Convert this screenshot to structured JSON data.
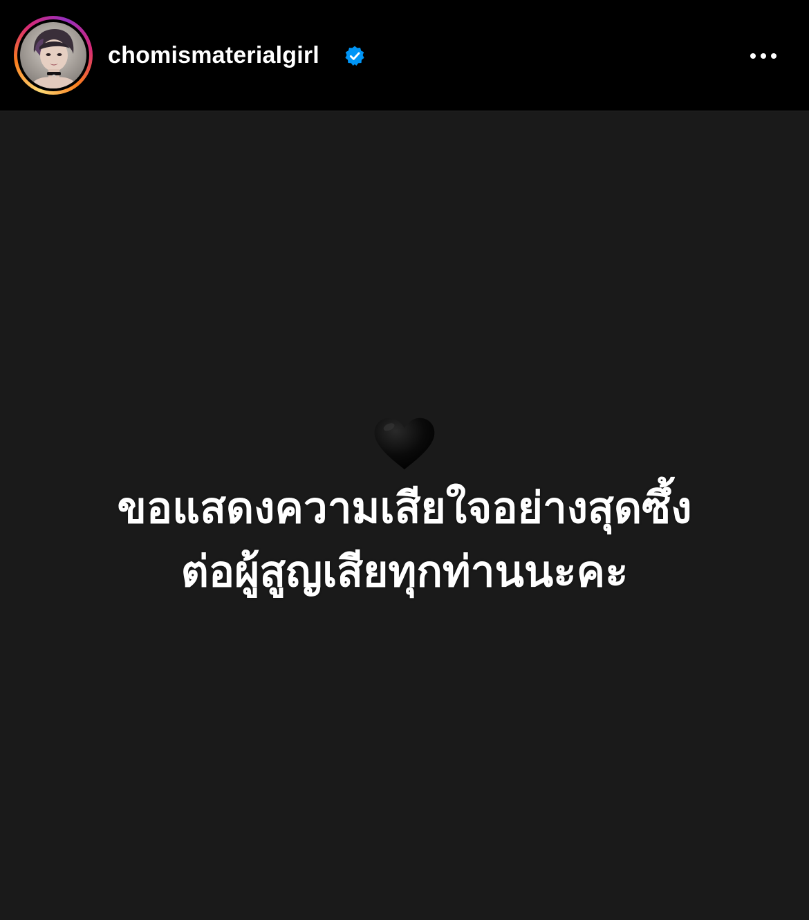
{
  "header": {
    "username": "chomismaterialgirl",
    "verified": true,
    "avatar_icon": "profile-avatar",
    "more_icon": "more-options-icon",
    "ring_colors": [
      "#feda75",
      "#fa7e1e",
      "#d62976",
      "#962fbf"
    ],
    "verified_color": "#0095f6"
  },
  "post": {
    "background_color": "#1a1a1a",
    "emoji": "black-heart-icon",
    "caption_lines": [
      "ขอแสดงความเสียใจอย่างสุดซึ้ง",
      "ต่อผู้สูญเสียทุกท่านนะคะ"
    ]
  }
}
